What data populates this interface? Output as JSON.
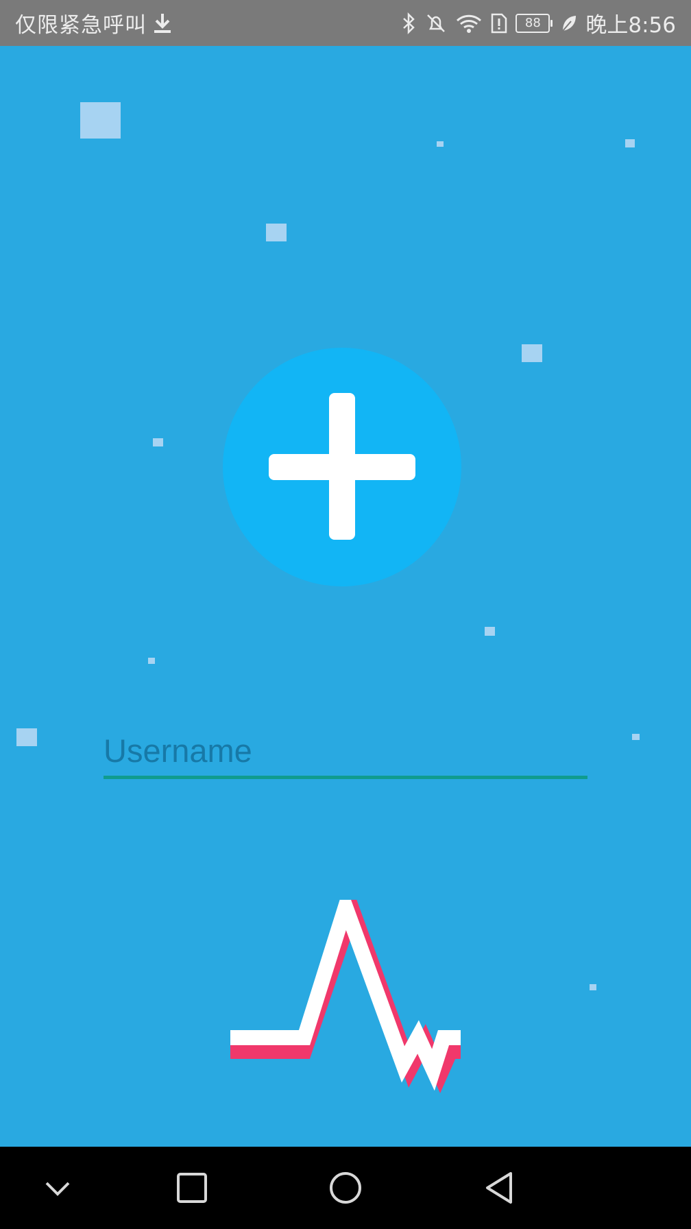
{
  "status_bar": {
    "carrier_text": "仅限紧急呼叫",
    "battery_level": "88",
    "time": "晚上8:56",
    "icons": [
      "download-icon",
      "bluetooth-icon",
      "mute-icon",
      "wifi-icon",
      "sim-alert-icon",
      "battery-icon",
      "leaf-icon"
    ]
  },
  "login": {
    "username_placeholder": "Username",
    "username_value": ""
  },
  "logo": {
    "icon": "plus-icon",
    "circle_color": "#12b5f5"
  },
  "pulse_logo": {
    "icon": "heartbeat-icon",
    "primary_color": "#ffffff",
    "shadow_color": "#f0386b"
  },
  "colors": {
    "background": "#29a9e1",
    "field_underline": "#0f9c8e",
    "status_bar": "#7a7a7a",
    "nav_bar": "#000000"
  },
  "nav_bar": {
    "buttons": [
      "collapse-icon",
      "recents-icon",
      "home-icon",
      "back-icon"
    ]
  }
}
